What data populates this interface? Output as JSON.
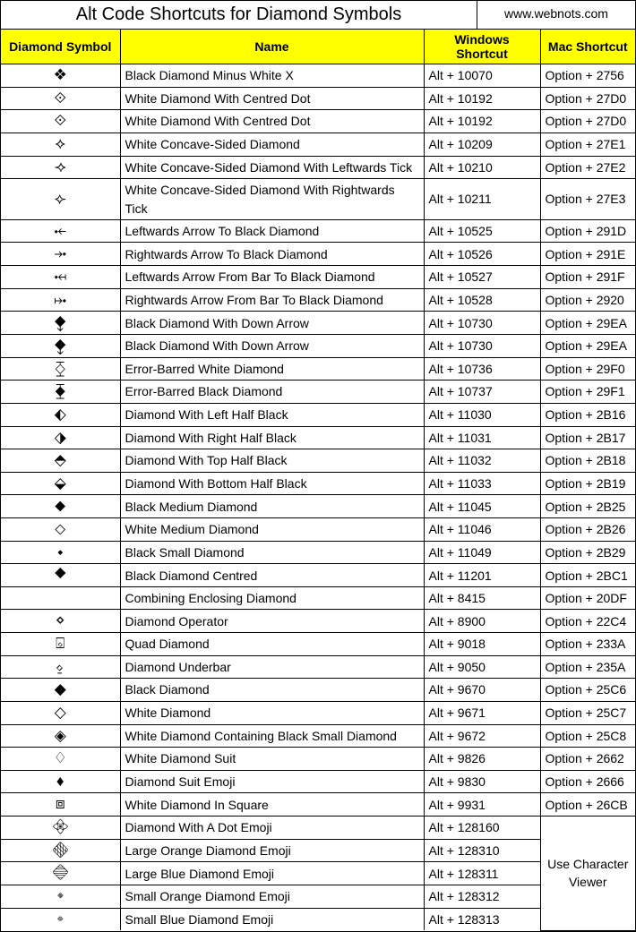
{
  "header": {
    "title": "Alt Code Shortcuts for Diamond Symbols",
    "url": "www.webnots.com"
  },
  "columns": {
    "symbol": "Diamond Symbol",
    "name": "Name",
    "windows": "Windows Shortcut",
    "mac": "Mac Shortcut"
  },
  "merged_mac_label": "Use Character Viewer",
  "rows": [
    {
      "symbol": "❖",
      "name": "Black Diamond Minus White X",
      "windows": "Alt + 10070",
      "mac": "Option + 2756"
    },
    {
      "symbol": "⟐",
      "name": "White Diamond With Centred Dot",
      "windows": "Alt + 10192",
      "mac": "Option + 27D0"
    },
    {
      "symbol": "⟐",
      "name": "White Diamond With Centred Dot",
      "windows": "Alt + 10192",
      "mac": "Option + 27D0"
    },
    {
      "symbol": "⟡",
      "name": "White Concave-Sided Diamond",
      "windows": "Alt + 10209",
      "mac": "Option + 27E1"
    },
    {
      "symbol": "⟢",
      "name": "White Concave-Sided Diamond With Leftwards Tick",
      "windows": "Alt + 10210",
      "mac": "Option + 27E2"
    },
    {
      "symbol": "⟣",
      "name": "White Concave-Sided Diamond With Rightwards Tick",
      "windows": "Alt + 10211",
      "mac": "Option + 27E3"
    },
    {
      "symbol": "⤝",
      "name": "Leftwards Arrow To Black Diamond",
      "windows": "Alt + 10525",
      "mac": "Option + 291D"
    },
    {
      "symbol": "⤞",
      "name": "Rightwards Arrow To Black Diamond",
      "windows": "Alt + 10526",
      "mac": "Option + 291E"
    },
    {
      "symbol": "⤟",
      "name": "Leftwards Arrow From Bar To Black Diamond",
      "windows": "Alt + 10527",
      "mac": "Option + 291F"
    },
    {
      "symbol": "⤠",
      "name": "Rightwards Arrow From Bar To Black Diamond",
      "windows": "Alt + 10528",
      "mac": "Option + 2920"
    },
    {
      "symbol": "⧪",
      "name": "Black Diamond With Down Arrow",
      "windows": "Alt + 10730",
      "mac": "Option + 29EA"
    },
    {
      "symbol": "⧪",
      "name": "Black Diamond With Down Arrow",
      "windows": "Alt + 10730",
      "mac": "Option + 29EA"
    },
    {
      "symbol": "⧰",
      "name": "Error-Barred White Diamond",
      "windows": "Alt + 10736",
      "mac": "Option + 29F0"
    },
    {
      "symbol": "⧱",
      "name": "Error-Barred Black Diamond",
      "windows": "Alt + 10737",
      "mac": "Option + 29F1"
    },
    {
      "symbol": "⬖",
      "name": "Diamond With Left Half Black",
      "windows": "Alt + 11030",
      "mac": "Option + 2B16"
    },
    {
      "symbol": "⬗",
      "name": "Diamond With Right Half Black",
      "windows": "Alt + 11031",
      "mac": "Option + 2B17"
    },
    {
      "symbol": "⬘",
      "name": "Diamond With Top Half Black",
      "windows": "Alt + 11032",
      "mac": "Option + 2B18"
    },
    {
      "symbol": "⬙",
      "name": "Diamond With Bottom Half Black",
      "windows": "Alt + 11033",
      "mac": "Option + 2B19"
    },
    {
      "symbol": "⬥",
      "name": "Black Medium Diamond",
      "windows": "Alt + 11045",
      "mac": "Option + 2B25"
    },
    {
      "symbol": "⬦",
      "name": "White Medium Diamond",
      "windows": "Alt + 11046",
      "mac": "Option + 2B26"
    },
    {
      "symbol": "⬩",
      "name": "Black Small Diamond",
      "windows": "Alt + 11049",
      "mac": "Option + 2B29"
    },
    {
      "symbol": "⯁",
      "name": "Black Diamond Centred",
      "windows": "Alt + 11201",
      "mac": "Option + 2BC1"
    },
    {
      "symbol": " ",
      "name": "Combining Enclosing Diamond",
      "windows": "Alt + 8415",
      "mac": "Option + 20DF"
    },
    {
      "symbol": "⋄",
      "name": "Diamond Operator",
      "windows": "Alt + 8900",
      "mac": "Option + 22C4"
    },
    {
      "symbol": "⌺",
      "name": "Quad Diamond",
      "windows": "Alt + 9018",
      "mac": "Option + 233A"
    },
    {
      "symbol": "⍚",
      "name": "Diamond Underbar",
      "windows": "Alt + 9050",
      "mac": "Option + 235A"
    },
    {
      "symbol": "◆",
      "name": "Black Diamond",
      "windows": "Alt + 9670",
      "mac": "Option + 25C6"
    },
    {
      "symbol": "◇",
      "name": "White Diamond",
      "windows": "Alt + 9671",
      "mac": "Option + 25C7"
    },
    {
      "symbol": "◈",
      "name": "White Diamond Containing Black Small Diamond",
      "windows": "Alt + 9672",
      "mac": "Option + 25C8"
    },
    {
      "symbol": "♢",
      "name": "White Diamond Suit",
      "windows": "Alt + 9826",
      "mac": "Option + 2662"
    },
    {
      "symbol": "♦",
      "name": "Diamond Suit Emoji",
      "windows": "Alt + 9830",
      "mac": "Option + 2666"
    },
    {
      "symbol": "⧈",
      "name": "White Diamond In Square",
      "windows": "Alt + 9931",
      "mac": "Option + 26CB"
    },
    {
      "symbol": "💠︎",
      "name": "Diamond With A Dot Emoji",
      "windows": "Alt + 128160",
      "mac": null
    },
    {
      "symbol": "🔶︎",
      "name": "Large Orange Diamond Emoji",
      "windows": "Alt + 128310",
      "mac": null
    },
    {
      "symbol": "🔷︎",
      "name": "Large Blue Diamond Emoji",
      "windows": "Alt + 128311",
      "mac": null
    },
    {
      "symbol": "🔸︎",
      "name": "Small Orange Diamond Emoji",
      "windows": "Alt + 128312",
      "mac": null
    },
    {
      "symbol": "🔹︎",
      "name": "Small Blue Diamond Emoji",
      "windows": "Alt + 128313",
      "mac": null
    }
  ]
}
